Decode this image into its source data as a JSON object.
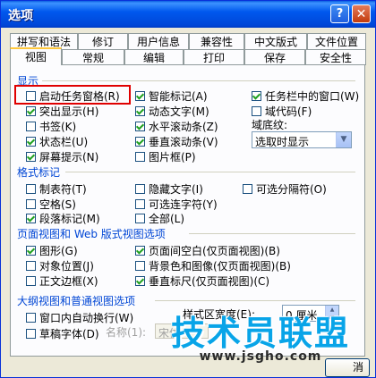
{
  "window": {
    "title": "选项",
    "help_glyph": "?",
    "close_glyph": "✕"
  },
  "tabs_row1": [
    "拼写和语法",
    "修订",
    "用户信息",
    "兼容性",
    "中文版式",
    "文件位置"
  ],
  "tabs_row2": [
    "视图",
    "常规",
    "编辑",
    "打印",
    "保存",
    "安全性"
  ],
  "groups": {
    "show": "显示",
    "format_marks": "格式标记",
    "page_web": "页面视图和 Web 版式视图选项",
    "outline": "大纲视图和普通视图选项"
  },
  "show_options": [
    {
      "label": "启动任务窗格(R)",
      "checked": false
    },
    {
      "label": "智能标记(A)",
      "checked": true
    },
    {
      "label": "任务栏中的窗口(W)",
      "checked": true
    },
    {
      "label": "突出显示(H)",
      "checked": true
    },
    {
      "label": "动态文字(M)",
      "checked": true
    },
    {
      "label": "域代码(F)",
      "checked": false
    },
    {
      "label": "书签(K)",
      "checked": false
    },
    {
      "label": "水平滚动条(Z)",
      "checked": true
    },
    {
      "label": "状态栏(U)",
      "checked": true
    },
    {
      "label": "垂直滚动条(V)",
      "checked": true
    },
    {
      "label": "屏幕提示(N)",
      "checked": true
    },
    {
      "label": "图片框(P)",
      "checked": false
    }
  ],
  "field_shading": {
    "label": "域底纹:",
    "value": "选取时显示"
  },
  "format_options": [
    {
      "label": "制表符(T)",
      "checked": false
    },
    {
      "label": "隐藏文字(I)",
      "checked": false
    },
    {
      "label": "可选分隔符(O)",
      "checked": false
    },
    {
      "label": "空格(S)",
      "checked": false
    },
    {
      "label": "可选连字符(Y)",
      "checked": false
    },
    {
      "label": "段落标记(M)",
      "checked": true
    },
    {
      "label": "全部(L)",
      "checked": false
    }
  ],
  "page_options": [
    {
      "label": "图形(G)",
      "checked": true
    },
    {
      "label": "页面间空白(仅页面视图)(B)",
      "checked": true
    },
    {
      "label": "对象位置(J)",
      "checked": false
    },
    {
      "label": "背景色和图像(仅页面视图)(B)",
      "checked": false
    },
    {
      "label": "正文边框(X)",
      "checked": false
    },
    {
      "label": "垂直标尺(仅页面视图)(C)",
      "checked": true
    }
  ],
  "outline_options": [
    {
      "label": "窗口内自动换行(W)",
      "checked": false
    },
    {
      "label": "草稿字体(D)",
      "checked": false
    }
  ],
  "style_width": {
    "label": "样式区宽度(E):",
    "value": "0 厘米"
  },
  "font_name": {
    "label": "名称(1):",
    "value": "宋体"
  },
  "watermark": {
    "main": "技术员联盟",
    "url": "www.jsgho.com"
  },
  "button_partial": "消"
}
